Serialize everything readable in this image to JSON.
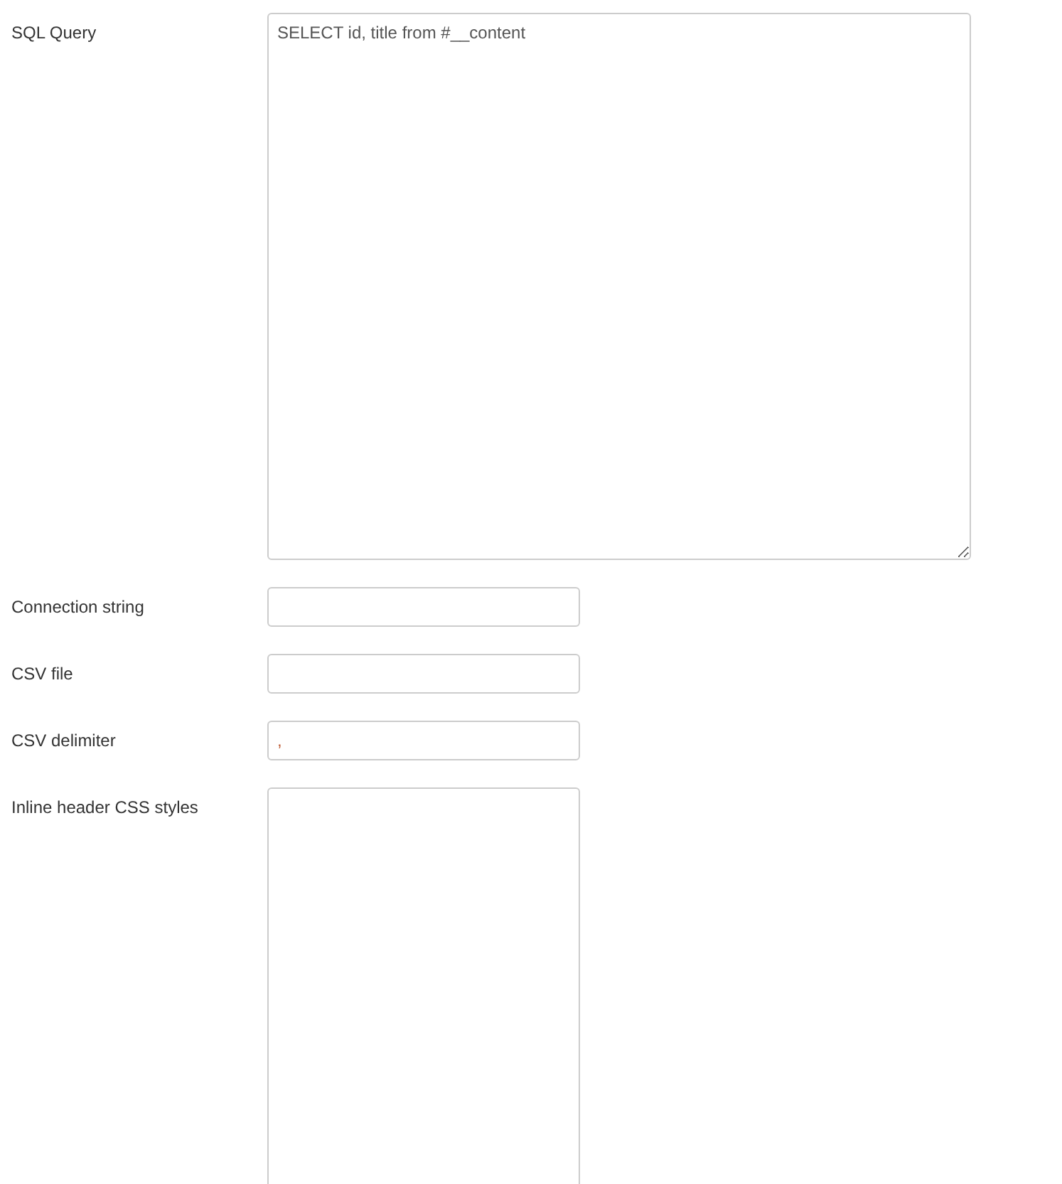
{
  "fields": [
    {
      "label": "SQL Query",
      "kind": "wide",
      "value": "SELECT id, title from #__content"
    },
    {
      "label": "Connection string",
      "kind": "input"
    },
    {
      "label": "CSV file",
      "kind": "input"
    },
    {
      "label": "CSV delimiter",
      "kind": "input",
      "value": ","
    },
    {
      "label": "Inline header CSS styles",
      "kind": "textarea"
    }
  ]
}
